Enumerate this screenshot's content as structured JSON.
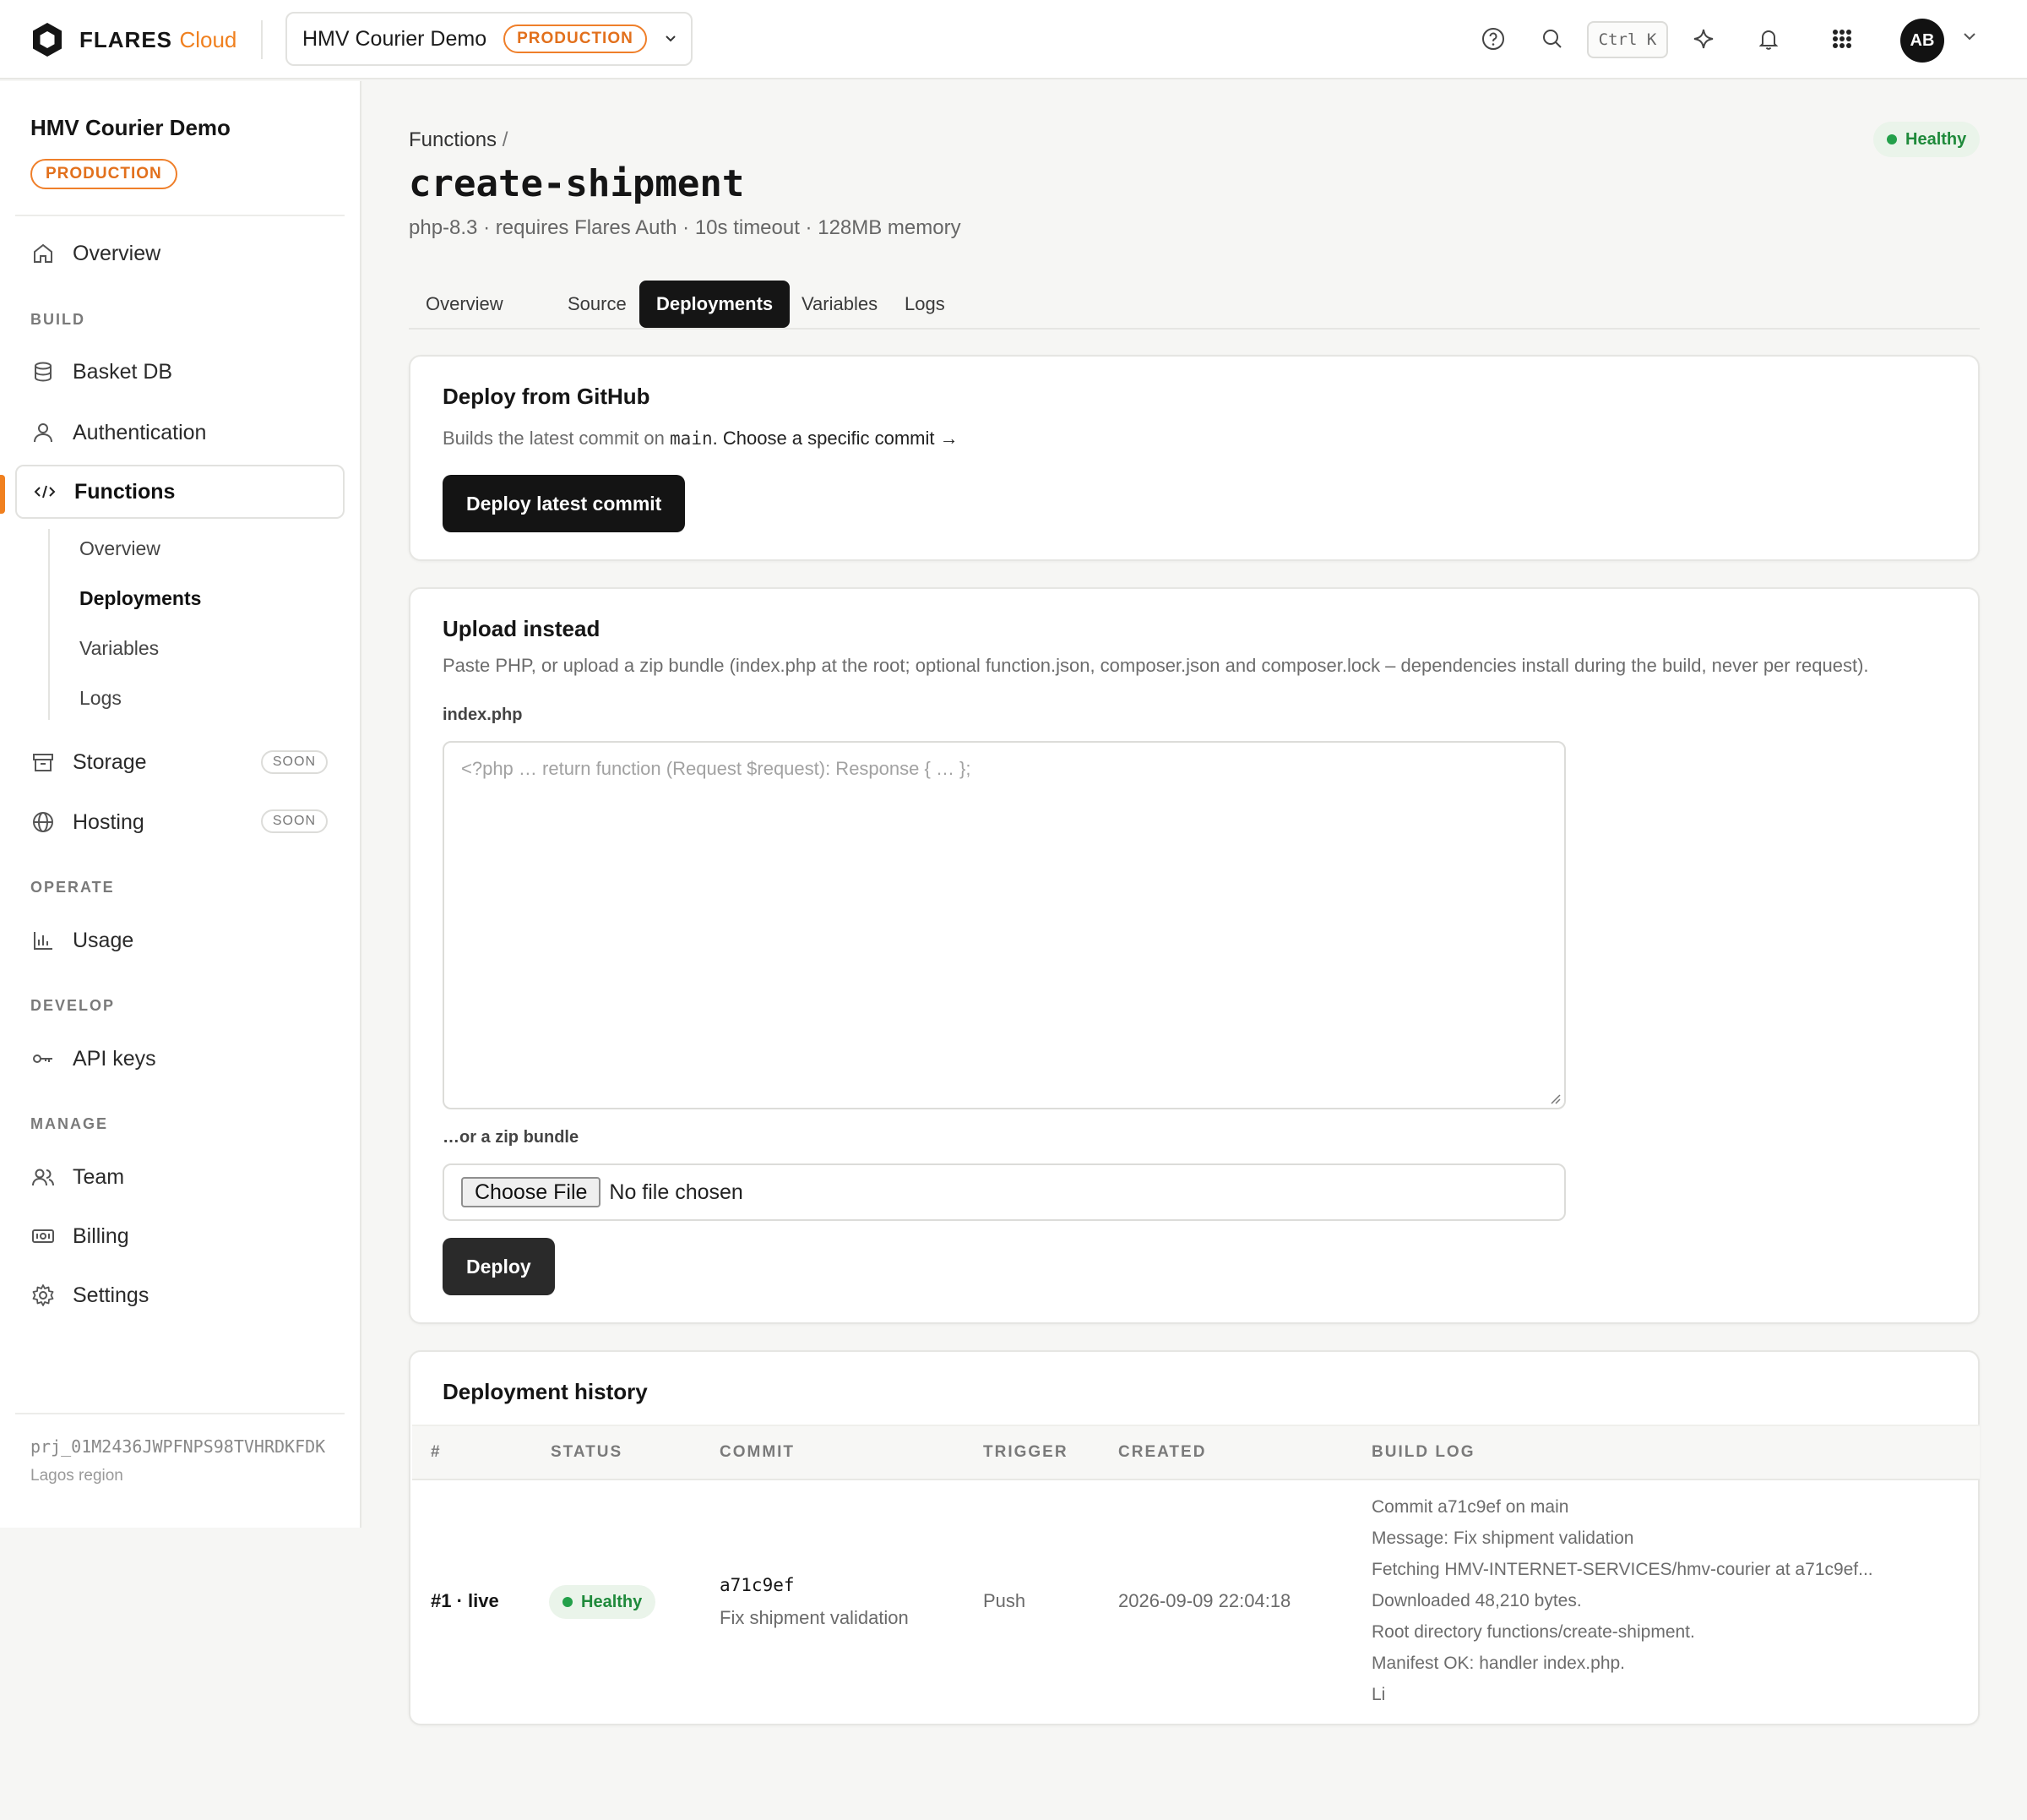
{
  "header": {
    "brand": "FLARES",
    "brand_sub": "Cloud",
    "project_name": "HMV Courier Demo",
    "env_badge": "PRODUCTION",
    "shortcut": "Ctrl K",
    "avatar_initials": "AB"
  },
  "sidebar": {
    "project_title": "HMV Courier Demo",
    "env_badge": "PRODUCTION",
    "overview": "Overview",
    "sections": {
      "build": "BUILD",
      "operate": "OPERATE",
      "develop": "DEVELOP",
      "manage": "MANAGE"
    },
    "items": {
      "basket_db": "Basket DB",
      "authentication": "Authentication",
      "functions": "Functions",
      "storage": "Storage",
      "hosting": "Hosting",
      "usage": "Usage",
      "api_keys": "API keys",
      "team": "Team",
      "billing": "Billing",
      "settings": "Settings"
    },
    "functions_sub": [
      "Overview",
      "Deployments",
      "Variables",
      "Logs"
    ],
    "soon_label": "SOON",
    "project_id": "prj_01M2436JWPFNPS98TVHRDKFDK",
    "region": "Lagos region"
  },
  "page": {
    "breadcrumb_parent": "Functions",
    "breadcrumb_sep": "/",
    "title": "create-shipment",
    "meta": "php-8.3 · requires Flares Auth · 10s timeout · 128MB memory",
    "health": "Healthy",
    "tabs": [
      "Overview",
      "Source",
      "Deployments",
      "Variables",
      "Logs"
    ],
    "active_tab": "Deployments"
  },
  "github_card": {
    "title": "Deploy from GitHub",
    "desc_prefix": "Builds the latest commit on",
    "branch": "main",
    "link": "Choose a specific commit →",
    "button": "Deploy latest commit"
  },
  "upload_card": {
    "title": "Upload instead",
    "desc": "Paste PHP, or upload a zip bundle (index.php at the root; optional function.json, composer.json and composer.lock – dependencies install during the build, never per request).",
    "code_label": "index.php",
    "code_placeholder": "<?php … return function (Request $request): Response { … };",
    "zip_label": "…or a zip bundle",
    "file_button": "Choose File",
    "file_status": "No file chosen",
    "deploy_button": "Deploy"
  },
  "history": {
    "title": "Deployment history",
    "columns": [
      "#",
      "STATUS",
      "COMMIT",
      "TRIGGER",
      "CREATED",
      "BUILD LOG"
    ],
    "rows": [
      {
        "id": "#1 · live",
        "status": "Healthy",
        "commit_hash": "a71c9ef",
        "commit_msg": "Fix shipment validation",
        "trigger": "Push",
        "created": "2026-09-09 22:04:18",
        "log": [
          "Commit a71c9ef on main",
          "Message: Fix shipment validation",
          "Fetching HMV-INTERNET-SERVICES/hmv-courier at a71c9ef...",
          "Downloaded 48,210 bytes.",
          "Root directory functions/create-shipment.",
          "Manifest OK: handler index.php.",
          "Li"
        ]
      }
    ]
  },
  "colors": {
    "accent": "#f0801f",
    "healthy": "#1f8a3b",
    "dark": "#141414"
  }
}
